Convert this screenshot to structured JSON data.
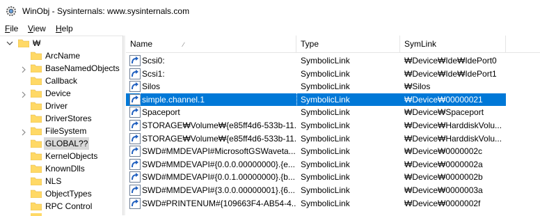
{
  "window": {
    "title": "WinObj - Sysinternals: www.sysinternals.com"
  },
  "menu": [
    {
      "key": "F",
      "rest": "ile"
    },
    {
      "key": "V",
      "rest": "iew"
    },
    {
      "key": "H",
      "rest": "elp"
    }
  ],
  "tree": {
    "root_label": "₩",
    "items": [
      {
        "label": "ArcName",
        "expandable": false
      },
      {
        "label": "BaseNamedObjects",
        "expandable": true
      },
      {
        "label": "Callback",
        "expandable": false
      },
      {
        "label": "Device",
        "expandable": true
      },
      {
        "label": "Driver",
        "expandable": false
      },
      {
        "label": "DriverStores",
        "expandable": false
      },
      {
        "label": "FileSystem",
        "expandable": true
      },
      {
        "label": "GLOBAL??",
        "expandable": false,
        "selected": true
      },
      {
        "label": "KernelObjects",
        "expandable": false
      },
      {
        "label": "KnownDlls",
        "expandable": false
      },
      {
        "label": "NLS",
        "expandable": false
      },
      {
        "label": "ObjectTypes",
        "expandable": false
      },
      {
        "label": "RPC Control",
        "expandable": false
      }
    ]
  },
  "list": {
    "columns": {
      "name": "Name",
      "type": "Type",
      "symlink": "SymLink"
    },
    "sort_indicator": "∕",
    "rows": [
      {
        "name": "Scsi0:",
        "type": "SymbolicLink",
        "symlink": "₩Device₩Ide₩IdePort0"
      },
      {
        "name": "Scsi1:",
        "type": "SymbolicLink",
        "symlink": "₩Device₩Ide₩IdePort1"
      },
      {
        "name": "Silos",
        "type": "SymbolicLink",
        "symlink": "₩Silos"
      },
      {
        "name": "simple.channel.1",
        "type": "SymbolicLink",
        "symlink": "₩Device₩00000021",
        "selected": true
      },
      {
        "name": "Spaceport",
        "type": "SymbolicLink",
        "symlink": "₩Device₩Spaceport"
      },
      {
        "name": "STORAGE₩Volume₩{e85ff4d6-533b-11...",
        "type": "SymbolicLink",
        "symlink": "₩Device₩HarddiskVolu..."
      },
      {
        "name": "STORAGE₩Volume₩{e85ff4d6-533b-11...",
        "type": "SymbolicLink",
        "symlink": "₩Device₩HarddiskVolu..."
      },
      {
        "name": "SWD#MMDEVAPI#MicrosoftGSWaveta...",
        "type": "SymbolicLink",
        "symlink": "₩Device₩0000002c"
      },
      {
        "name": "SWD#MMDEVAPI#{0.0.0.00000000}.{e...",
        "type": "SymbolicLink",
        "symlink": "₩Device₩0000002a"
      },
      {
        "name": "SWD#MMDEVAPI#{0.0.1.00000000}.{b...",
        "type": "SymbolicLink",
        "symlink": "₩Device₩0000002b"
      },
      {
        "name": "SWD#MMDEVAPI#{3.0.0.00000001}.{6...",
        "type": "SymbolicLink",
        "symlink": "₩Device₩0000003a"
      },
      {
        "name": "SWD#PRINTENUM#{109663F4-AB54-4...",
        "type": "SymbolicLink",
        "symlink": "₩Device₩0000002f"
      }
    ]
  },
  "colors": {
    "selection": "#0078d7",
    "folder": "#ffd966",
    "tree_selection": "#d9d9d9"
  }
}
